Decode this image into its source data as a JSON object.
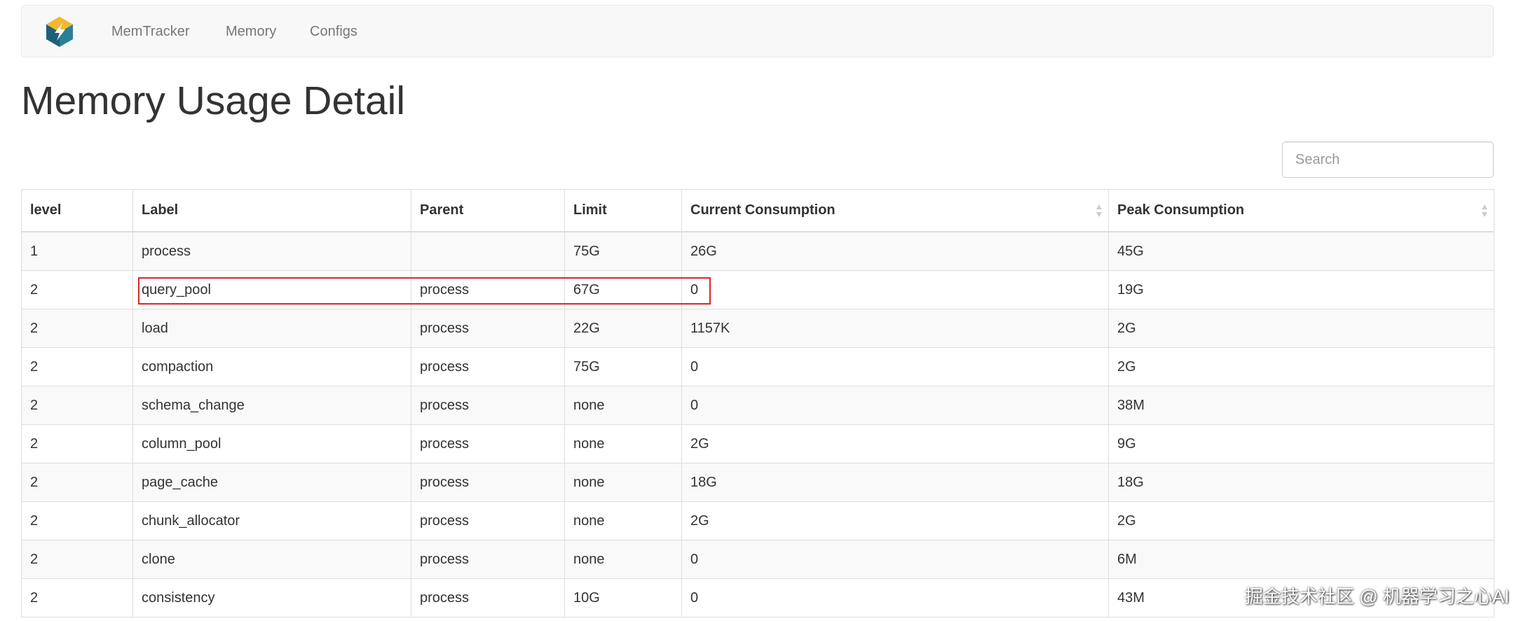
{
  "navbar": {
    "brand_icon": "brand-logo-icon",
    "items": [
      {
        "label": "MemTracker"
      },
      {
        "label": "Memory"
      },
      {
        "label": "Configs"
      }
    ]
  },
  "page_title": "Memory Usage Detail",
  "search": {
    "placeholder": "Search",
    "value": ""
  },
  "table": {
    "columns": [
      "level",
      "Label",
      "Parent",
      "Limit",
      "Current Consumption",
      "Peak Consumption"
    ],
    "sortable_columns": [
      "Current Consumption",
      "Peak Consumption"
    ],
    "rows": [
      [
        "1",
        "process",
        "",
        "75G",
        "26G",
        "45G"
      ],
      [
        "2",
        "query_pool",
        "process",
        "67G",
        "0",
        "19G"
      ],
      [
        "2",
        "load",
        "process",
        "22G",
        "1157K",
        "2G"
      ],
      [
        "2",
        "compaction",
        "process",
        "75G",
        "0",
        "2G"
      ],
      [
        "2",
        "schema_change",
        "process",
        "none",
        "0",
        "38M"
      ],
      [
        "2",
        "column_pool",
        "process",
        "none",
        "2G",
        "9G"
      ],
      [
        "2",
        "page_cache",
        "process",
        "none",
        "18G",
        "18G"
      ],
      [
        "2",
        "chunk_allocator",
        "process",
        "none",
        "2G",
        "2G"
      ],
      [
        "2",
        "clone",
        "process",
        "none",
        "0",
        "6M"
      ],
      [
        "2",
        "consistency",
        "process",
        "10G",
        "0",
        "43M"
      ]
    ]
  },
  "highlight_color": "#d9262d",
  "watermark": "掘金技术社区 @ 机器学习之心AI"
}
